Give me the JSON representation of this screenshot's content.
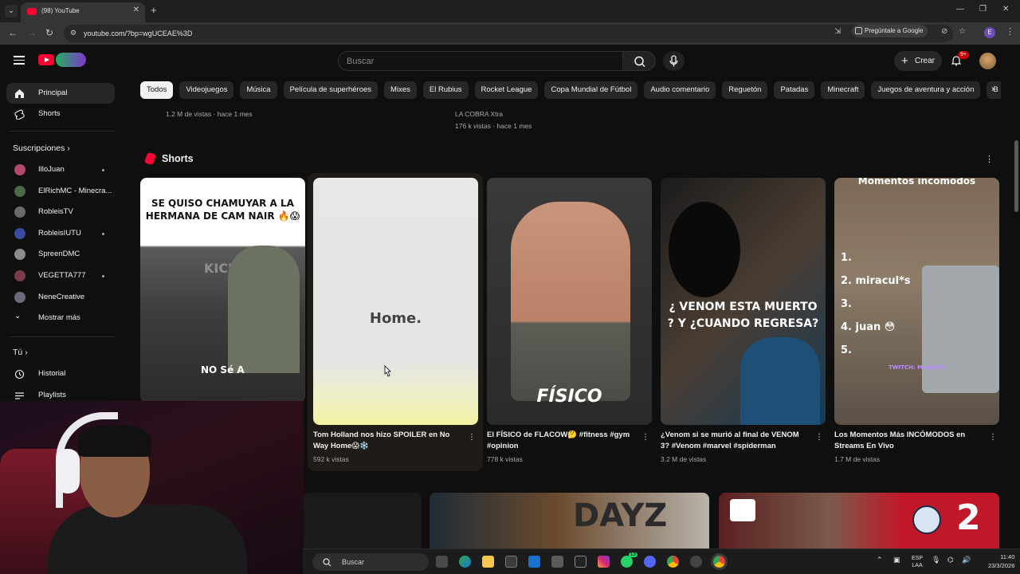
{
  "browser": {
    "tab_title": "(98) YouTube",
    "url": "youtube.com/?bp=wgUCEAE%3D",
    "gemini_label": "Pregúntale a Google",
    "profile_initial": "E"
  },
  "masthead": {
    "search_placeholder": "Buscar",
    "create_label": "Crear",
    "notifications_badge": "9+"
  },
  "chips": [
    "Todos",
    "Videojuegos",
    "Música",
    "Película de superhéroes",
    "Mixes",
    "El Rubius",
    "Rocket League",
    "Copa Mundial de Fútbol",
    "Audio comentario",
    "Reguetón",
    "Patadas",
    "Minecraft",
    "Juegos de aventura y acción",
    "B"
  ],
  "sidebar": {
    "home": "Principal",
    "shorts": "Shorts",
    "subscriptions_header": "Suscripciones",
    "channels": [
      {
        "name": "IlloJuan",
        "color": "#b04a6a",
        "live": true
      },
      {
        "name": "ElRichMC - Minecra...",
        "color": "#4a6b4a",
        "live": false
      },
      {
        "name": "RobleisTV",
        "color": "#6a6a6a",
        "live": false
      },
      {
        "name": "RobleisIUTU",
        "color": "#3a4aa0",
        "live": true
      },
      {
        "name": "SpreenDMC",
        "color": "#8a8a8a",
        "live": false
      },
      {
        "name": "VEGETTA777",
        "color": "#7a3a4a",
        "live": true
      },
      {
        "name": "NeneCreative",
        "color": "#6a6a7a",
        "live": false
      }
    ],
    "show_more": "Mostrar más",
    "you_header": "Tú",
    "history": "Historial",
    "playlists": "Playlists"
  },
  "previous_row": {
    "meta_left": "1.2 M de vistas · hace 1 mes",
    "channel_right": "LA COBRA Xtra",
    "meta_right": "176 k vistas · hace 1 mes"
  },
  "shorts": {
    "section_title": "Shorts",
    "items": [
      {
        "title": "",
        "views": "",
        "overlay_top": "SE QUISO CHAMUYAR A LA HERMANA DE CAM NAIR 🔥😱",
        "overlay_bottom": "NO Sé A",
        "watermark": "KICK"
      },
      {
        "title": "Tom Holland nos hizo SPOILER en No Way Home😱❄️",
        "views": "592 k vistas",
        "overlay_text": "Home."
      },
      {
        "title": "El FÍSICO de FLACOW🤔 #fitness #gym #opinion",
        "views": "778 k vistas",
        "overlay_text": "FÍSICO"
      },
      {
        "title": "¿Venom si se murió al final de VENOM 3? #Venom #marvel #spiderman",
        "views": "3.2 M de vistas",
        "overlay_text": "¿ VENOM ESTA MUERTO ? Y ¿CUANDO REGRESA?"
      },
      {
        "title": "Los Momentos Más INCÓMODOS en Streams En Vivo",
        "views": "1.7 M de vistas",
        "overlay_title": "Momentos incómodos",
        "list": [
          "1.",
          "2. miracul*s",
          "3. ",
          "4. juan 😳",
          "5."
        ],
        "twitch_tag": "TWITCH: MojaADV"
      }
    ]
  },
  "bottom_row": {
    "dayz_text": "DAYZ",
    "score_text": "2"
  },
  "taskbar": {
    "search_label": "Buscar",
    "lang": "ESP",
    "lang_sub": "LAA",
    "time": "11:40",
    "date": "23/3/2026",
    "whatsapp_badge": "13"
  }
}
